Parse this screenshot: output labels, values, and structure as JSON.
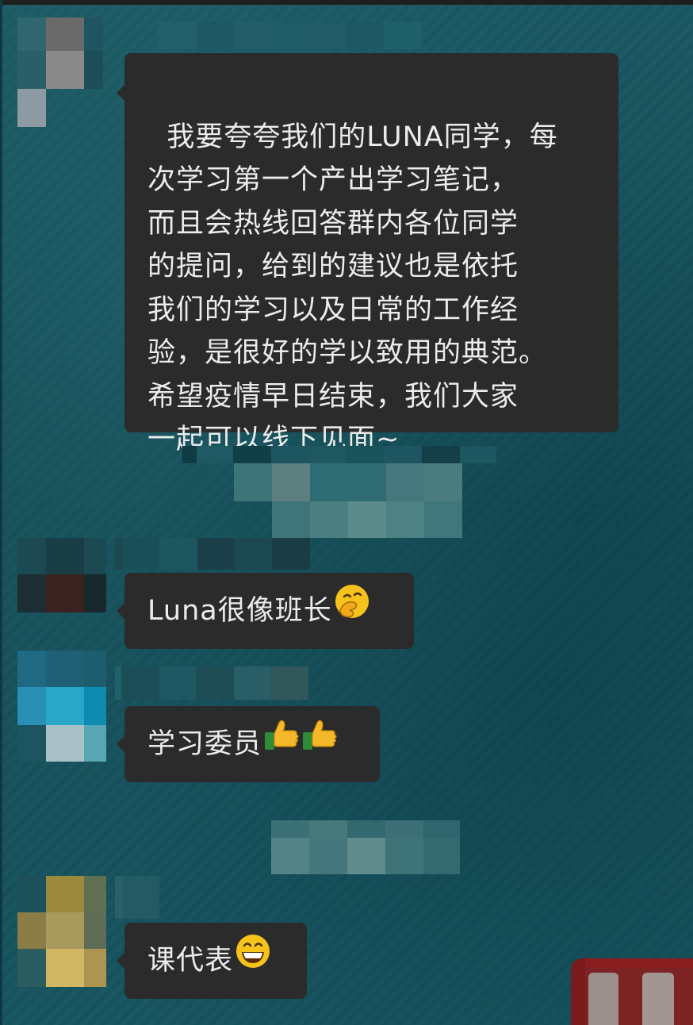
{
  "chat": {
    "messages": [
      {
        "text": "我要夸夸我们的LUNA同学，每\n次学习第一个产出学习笔记，\n而且会热线回答群内各位同学\n的提问，给到的建议也是依托\n我们的学习以及日常的工作经\n验，是很好的学以致用的典范。\n希望疫情早日结束，我们大家\n一起可以线下见面~"
      },
      {
        "text": "Luna很像班长",
        "emoji": "hand-over-mouth-emoji"
      },
      {
        "text": "学习委员",
        "emoji": "thumbs-up-emoji"
      },
      {
        "text": "课代表",
        "emoji": "grinning-face-emoji"
      }
    ]
  },
  "colors": {
    "background": "#16505a",
    "bubble": "#2b2b2b",
    "bubble_text": "#ececec"
  }
}
